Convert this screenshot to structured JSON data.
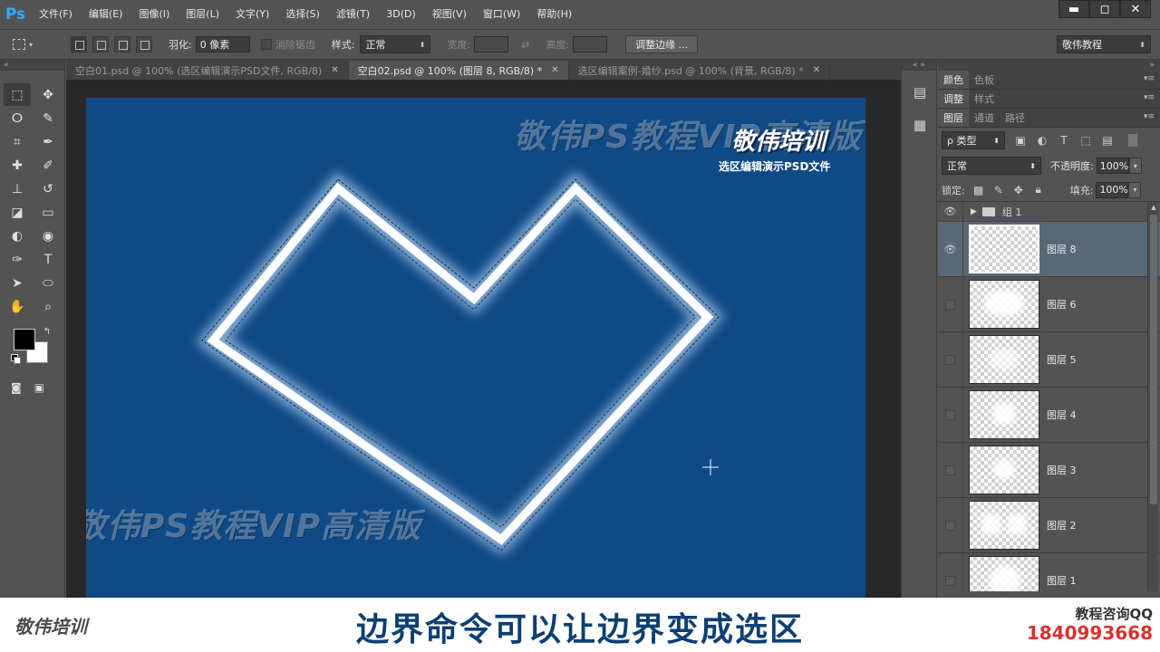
{
  "app": {
    "logo": "Ps"
  },
  "menu": [
    "文件(F)",
    "编辑(E)",
    "图像(I)",
    "图层(L)",
    "文字(Y)",
    "选择(S)",
    "滤镜(T)",
    "3D(D)",
    "视图(V)",
    "窗口(W)",
    "帮助(H)"
  ],
  "window_controls": {
    "minimize": "▬",
    "restore": "◻",
    "close": "✕"
  },
  "options": {
    "feather_label": "羽化:",
    "feather_value": "0 像素",
    "antialias_label": "消除锯齿",
    "style_label": "样式:",
    "style_value": "正常",
    "width_label": "宽度:",
    "height_label": "高度:",
    "refine_button": "调整边缘 ...",
    "workspace_value": "敬伟教程"
  },
  "doc_tabs": [
    {
      "label": "空白01.psd @ 100% (选区编辑演示PSD文件, RGB/8)",
      "close": "✕"
    },
    {
      "label": "空白02.psd @ 100% (图层 8, RGB/8) *",
      "close": "✕"
    },
    {
      "label": "选区编辑案例-婚纱.psd @ 100% (背景, RGB/8) *",
      "close": "✕"
    }
  ],
  "canvas": {
    "background": "#0f4a86",
    "watermark_top": "敬伟PS教程VIP高清版",
    "watermark_bottom": "敬伟PS教程VIP高清版",
    "brand": "敬伟培训",
    "subtitle": "选区编辑演示PSD文件"
  },
  "panels": {
    "top_tabs": [
      "颜色",
      "色板"
    ],
    "mid_tabs": [
      "调整",
      "样式"
    ],
    "layer_tabs": [
      "图层",
      "通道",
      "路径"
    ],
    "kind_label": "ρ 类型",
    "blend_mode": "正常",
    "opacity_label": "不透明度:",
    "opacity_value": "100%",
    "lock_label": "锁定:",
    "fill_label": "填充:",
    "fill_value": "100%",
    "group_name": "组 1",
    "layers": [
      {
        "name": "图层 8",
        "selected": true,
        "visible": true
      },
      {
        "name": "图层 6",
        "selected": false,
        "visible": false
      },
      {
        "name": "图层 5",
        "selected": false,
        "visible": false
      },
      {
        "name": "图层 4",
        "selected": false,
        "visible": false
      },
      {
        "name": "图层 3",
        "selected": false,
        "visible": false
      },
      {
        "name": "图层 2",
        "selected": false,
        "visible": false
      },
      {
        "name": "图层 1",
        "selected": false,
        "visible": false
      }
    ]
  },
  "subtitle_bar": {
    "logo": "敬伟培训",
    "caption": "边界命令可以让边界变成选区",
    "contact_label": "教程咨询QQ",
    "contact_number": "1840993668"
  }
}
